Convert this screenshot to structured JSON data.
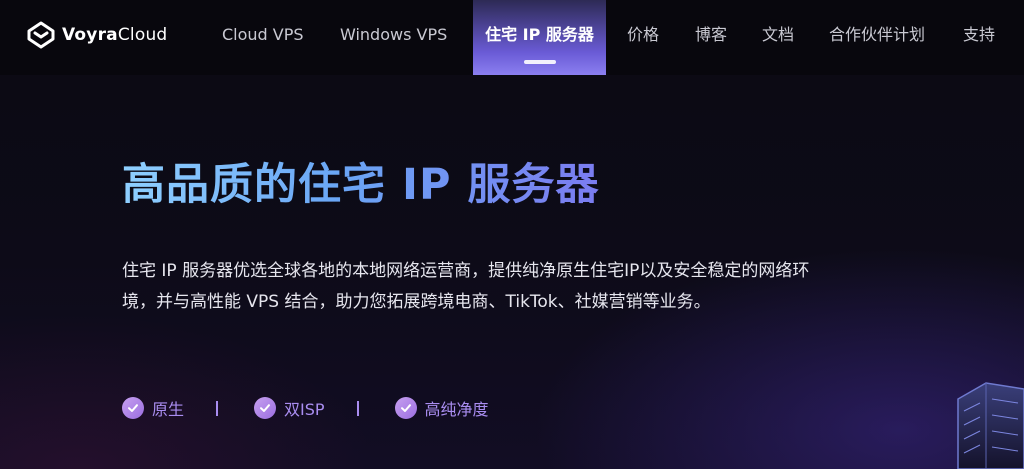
{
  "brand": {
    "name_part1": "Voyra",
    "name_part2": "Cloud"
  },
  "nav": {
    "items": [
      {
        "label": "Cloud VPS"
      },
      {
        "label": "Windows VPS"
      },
      {
        "label": "住宅 IP 服务器"
      },
      {
        "label": "价格"
      },
      {
        "label": "博客"
      },
      {
        "label": "文档"
      },
      {
        "label": "合作伙伴计划"
      },
      {
        "label": "支持"
      }
    ],
    "active_index": 2
  },
  "hero": {
    "title": "高品质的住宅 IP 服务器",
    "description": "住宅 IP 服务器优选全球各地的本地网络运营商，提供纯净原生住宅IP以及安全稳定的网络环境，并与高性能 VPS 结合，助力您拓展跨境电商、TikTok、社媒营销等业务。"
  },
  "features": [
    {
      "label": "原生",
      "icon": "check-circle-icon"
    },
    {
      "label": "双ISP",
      "icon": "check-circle-icon"
    },
    {
      "label": "高纯净度",
      "icon": "check-circle-icon"
    }
  ],
  "colors": {
    "accent": "#8b7ff0",
    "title_gradient_start": "#8fd0ff",
    "title_gradient_end": "#7b7cf0",
    "feature_text": "#a98df0",
    "background": "#0a0912"
  }
}
